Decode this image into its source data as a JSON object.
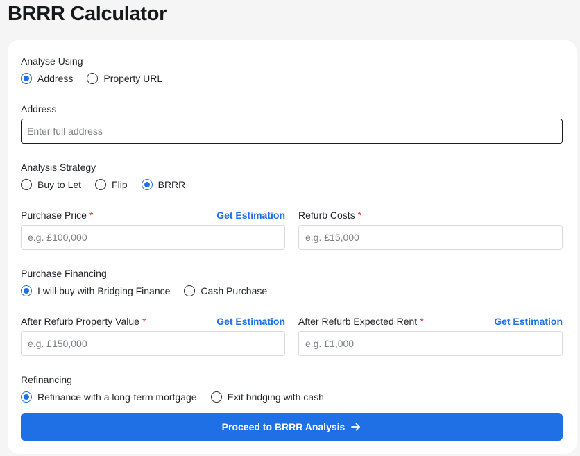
{
  "page": {
    "title": "BRRR Calculator"
  },
  "analyse_using": {
    "label": "Analyse Using",
    "options": [
      "Address",
      "Property URL"
    ],
    "selected": "Address"
  },
  "address": {
    "label": "Address",
    "placeholder": "Enter full address",
    "value": ""
  },
  "strategy": {
    "label": "Analysis Strategy",
    "options": [
      "Buy to Let",
      "Flip",
      "BRRR"
    ],
    "selected": "BRRR"
  },
  "purchase_price": {
    "label": "Purchase Price",
    "required_mark": "*",
    "link": "Get Estimation",
    "placeholder": "e.g. £100,000",
    "value": ""
  },
  "refurb_costs": {
    "label": "Refurb Costs",
    "required_mark": "*",
    "placeholder": "e.g. £15,000",
    "value": ""
  },
  "financing": {
    "label": "Purchase Financing",
    "options": [
      "I will buy with Bridging Finance",
      "Cash Purchase"
    ],
    "selected": "I will buy with Bridging Finance"
  },
  "after_value": {
    "label": "After Refurb Property Value",
    "required_mark": "*",
    "link": "Get Estimation",
    "placeholder": "e.g. £150,000",
    "value": ""
  },
  "after_rent": {
    "label": "After Refurb Expected Rent",
    "required_mark": "*",
    "link": "Get Estimation",
    "placeholder": "e.g. £1,000",
    "value": ""
  },
  "refinancing": {
    "label": "Refinancing",
    "options": [
      "Refinance with a long-term mortgage",
      "Exit bridging with cash"
    ],
    "selected": "Refinance with a long-term mortgage"
  },
  "submit": {
    "label": "Proceed to BRRR Analysis",
    "icon": "arrow-right-icon",
    "color": "#1f6fe5"
  },
  "colors": {
    "accent": "#1f6fe5",
    "required": "#e0312c",
    "background": "#f5f5f6"
  }
}
